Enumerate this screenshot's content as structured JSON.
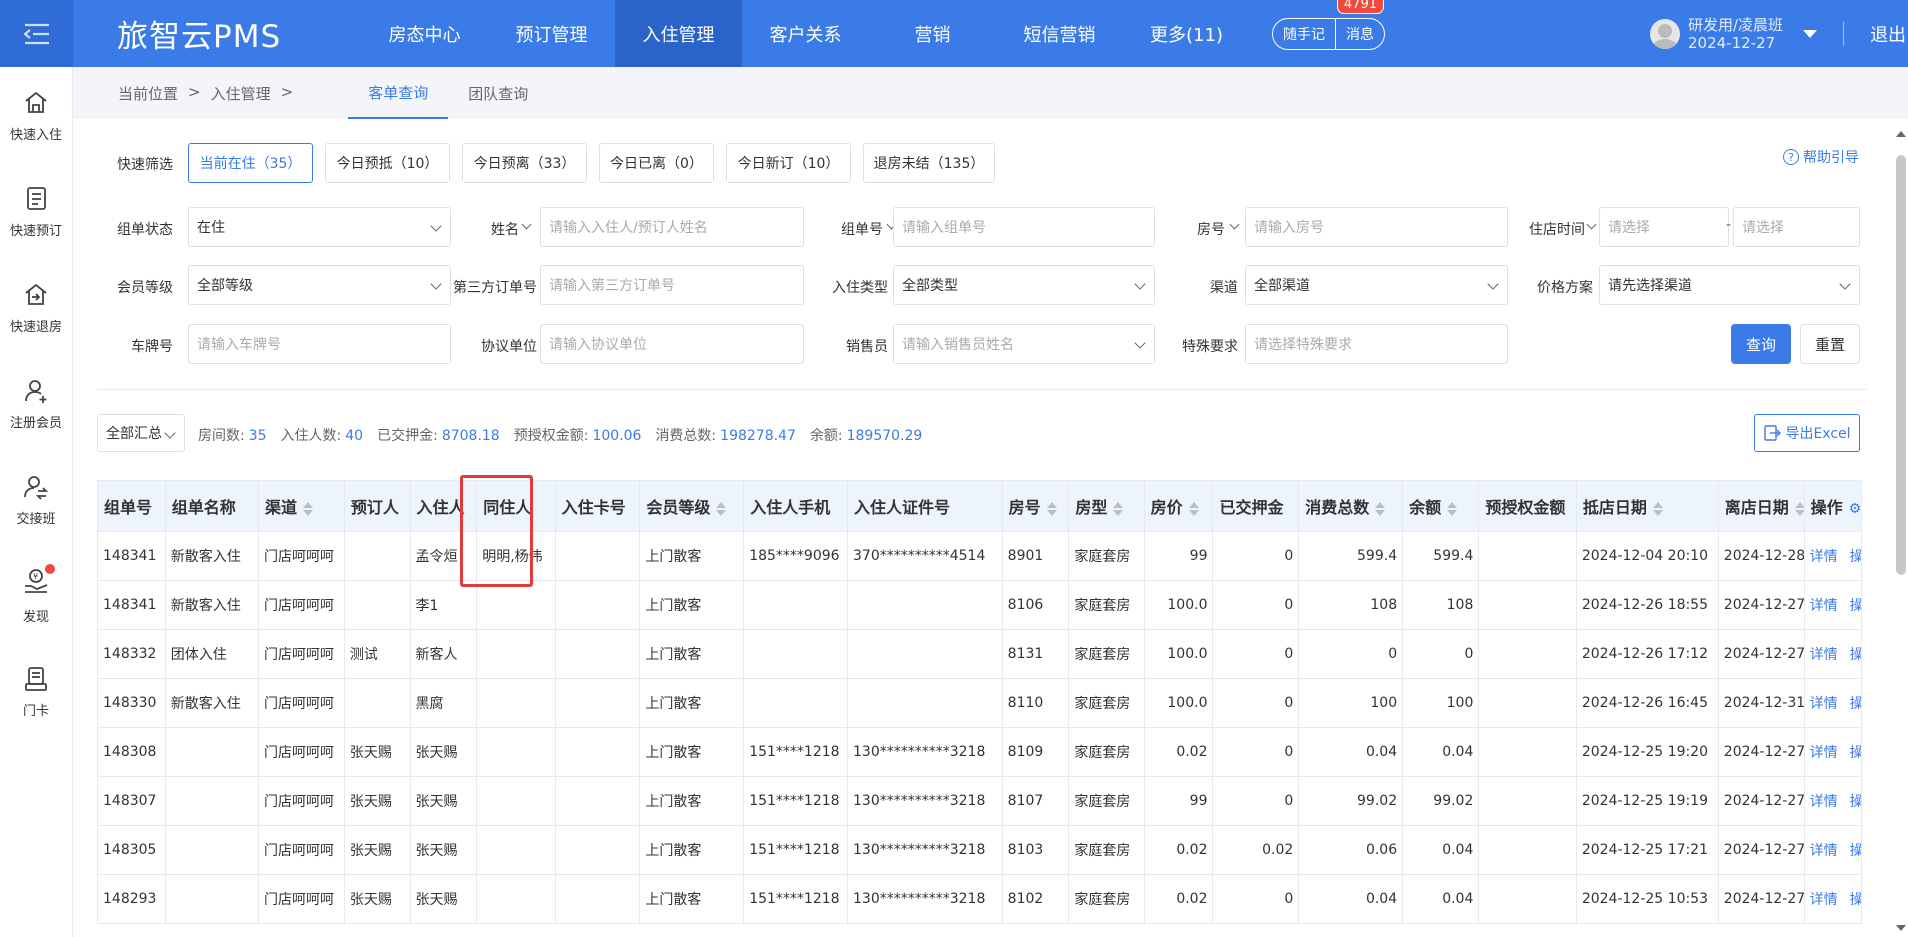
{
  "app": {
    "brand": "旅智云PMS",
    "nav": [
      "房态中心",
      "预订管理",
      "入住管理",
      "客户关系",
      "营销",
      "短信营销",
      "更多(11)"
    ],
    "active_nav": 2,
    "notes_label": "随手记",
    "messages_label": "消息",
    "messages_badge": "4791",
    "user_name": "研发用/凌晨班",
    "user_date": "2024-12-27",
    "logout_label": "退出"
  },
  "sidebar": [
    {
      "label": "快速入住",
      "icon": "home-icon"
    },
    {
      "label": "快速预订",
      "icon": "list-icon"
    },
    {
      "label": "快速退房",
      "icon": "checkout-icon"
    },
    {
      "label": "注册会员",
      "icon": "user-add-icon"
    },
    {
      "label": "交接班",
      "icon": "handover-icon"
    },
    {
      "label": "发现",
      "icon": "discover-icon"
    },
    {
      "label": "门卡",
      "icon": "card-icon"
    }
  ],
  "breadcrumb": {
    "prefix": "当前位置",
    "sep": ">",
    "section": "入住管理",
    "sep2": ">"
  },
  "tabs": [
    "客单查询",
    "团队查询"
  ],
  "quick_filter": {
    "label": "快速筛选",
    "options": [
      "当前在住（35）",
      "今日预抵（10）",
      "今日预离（33）",
      "今日已离（0）",
      "今日新订（10）",
      "退房未结（135）"
    ]
  },
  "help_label": "帮助引导",
  "filters": {
    "group_status": {
      "label": "组单状态",
      "value": "在住"
    },
    "name": {
      "label": "姓名",
      "placeholder": "请输入入住人/预订人姓名"
    },
    "group_no": {
      "label": "组单号",
      "placeholder": "请输入组单号"
    },
    "room_no": {
      "label": "房号",
      "placeholder": "请输入房号"
    },
    "stay_time": {
      "label": "住店时间",
      "placeholder_from": "请选择",
      "dash": "-",
      "placeholder_to": "请选择"
    },
    "member_level": {
      "label": "会员等级",
      "value": "全部等级"
    },
    "third_order": {
      "label": "第三方订单号",
      "placeholder": "请输入第三方订单号"
    },
    "checkin_type": {
      "label": "入住类型",
      "value": "全部类型"
    },
    "channel": {
      "label": "渠道",
      "value": "全部渠道"
    },
    "price_plan": {
      "label": "价格方案",
      "value": "请先选择渠道"
    },
    "plate": {
      "label": "车牌号",
      "placeholder": "请输入车牌号"
    },
    "agreement": {
      "label": "协议单位",
      "placeholder": "请输入协议单位"
    },
    "sales": {
      "label": "销售员",
      "placeholder": "请输入销售员姓名"
    },
    "special": {
      "label": "特殊要求",
      "placeholder": "请选择特殊要求"
    }
  },
  "buttons": {
    "search": "查询",
    "reset": "重置",
    "export": "导出Excel"
  },
  "summary": {
    "scope": "全部汇总",
    "items": [
      {
        "label": "房间数:",
        "value": "35"
      },
      {
        "label": "入住人数:",
        "value": "40"
      },
      {
        "label": "已交押金:",
        "value": "8708.18"
      },
      {
        "label": "预授权金额:",
        "value": "100.06"
      },
      {
        "label": "消费总数:",
        "value": "198278.47"
      },
      {
        "label": "余额:",
        "value": "189570.29"
      }
    ]
  },
  "table": {
    "columns": [
      "组单号",
      "组单名称",
      "渠道",
      "预订人",
      "入住人",
      "同住人",
      "入住卡号",
      "会员等级",
      "入住人手机",
      "入住人证件号",
      "房号",
      "房型",
      "房价",
      "已交押金",
      "消费总数",
      "余额",
      "预授权金额",
      "抵店日期",
      "离店日期",
      "操作"
    ],
    "rows": [
      [
        "148341",
        "新散客入住",
        "门店呵呵呵",
        "",
        "孟令烜",
        "明明,杨伟",
        "",
        "上门散客",
        "185****9096",
        "370**********4514",
        "8901",
        "家庭套房",
        "99",
        "0",
        "599.4",
        "599.4",
        "",
        "2024-12-04 20:10",
        "2024-12-28"
      ],
      [
        "148341",
        "新散客入住",
        "门店呵呵呵",
        "",
        "李1",
        "",
        "",
        "上门散客",
        "",
        "",
        "8106",
        "家庭套房",
        "100.0",
        "0",
        "108",
        "108",
        "",
        "2024-12-26 18:55",
        "2024-12-27"
      ],
      [
        "148332",
        "团体入住",
        "门店呵呵呵",
        "测试",
        "新客人",
        "",
        "",
        "上门散客",
        "",
        "",
        "8131",
        "家庭套房",
        "100.0",
        "0",
        "0",
        "0",
        "",
        "2024-12-26 17:12",
        "2024-12-27"
      ],
      [
        "148330",
        "新散客入住",
        "门店呵呵呵",
        "",
        "黑腐",
        "",
        "",
        "上门散客",
        "",
        "",
        "8110",
        "家庭套房",
        "100.0",
        "0",
        "100",
        "100",
        "",
        "2024-12-26 16:45",
        "2024-12-31"
      ],
      [
        "148308",
        "",
        "门店呵呵呵",
        "张天赐",
        "张天赐",
        "",
        "",
        "上门散客",
        "151****1218",
        "130**********3218",
        "8109",
        "家庭套房",
        "0.02",
        "0",
        "0.04",
        "0.04",
        "",
        "2024-12-25 19:20",
        "2024-12-27"
      ],
      [
        "148307",
        "",
        "门店呵呵呵",
        "张天赐",
        "张天赐",
        "",
        "",
        "上门散客",
        "151****1218",
        "130**********3218",
        "8107",
        "家庭套房",
        "99",
        "0",
        "99.02",
        "99.02",
        "",
        "2024-12-25 19:19",
        "2024-12-27"
      ],
      [
        "148305",
        "",
        "门店呵呵呵",
        "张天赐",
        "张天赐",
        "",
        "",
        "上门散客",
        "151****1218",
        "130**********3218",
        "8103",
        "家庭套房",
        "0.02",
        "0.02",
        "0.06",
        "0.04",
        "",
        "2024-12-25 17:21",
        "2024-12-27"
      ],
      [
        "148293",
        "",
        "门店呵呵呵",
        "张天赐",
        "张天赐",
        "",
        "",
        "上门散客",
        "151****1218",
        "130**********3218",
        "8102",
        "家庭套房",
        "0.02",
        "0",
        "0.04",
        "0.04",
        "",
        "2024-12-25 10:53",
        "2024-12-27"
      ]
    ],
    "row_actions": [
      "详情",
      "操作"
    ]
  }
}
